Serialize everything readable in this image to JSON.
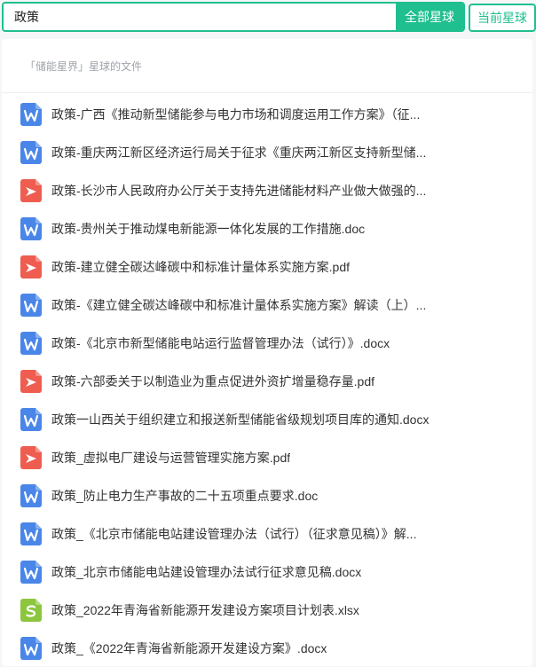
{
  "search": {
    "value": "政策",
    "all_button": "全部星球",
    "current_button": "当前星球"
  },
  "panel": {
    "title": "「储能星界」星球的文件"
  },
  "colors": {
    "accent": "#1fbf8f",
    "word": "#4a86e8",
    "pdf": "#ee5d4f",
    "excel": "#8cc63f"
  },
  "files": [
    {
      "type": "word",
      "icon": "word-file-icon",
      "name": "政策-广西《推动新型储能参与电力市场和调度运用工作方案》（征..."
    },
    {
      "type": "word",
      "icon": "word-file-icon",
      "name": "政策-重庆两江新区经济运行局关于征求《重庆两江新区支持新型储..."
    },
    {
      "type": "pdf",
      "icon": "pdf-file-icon",
      "name": "政策-长沙市人民政府办公厅关于支持先进储能材料产业做大做强的..."
    },
    {
      "type": "word",
      "icon": "word-file-icon",
      "name": "政策-贵州关于推动煤电新能源一体化发展的工作措施.doc"
    },
    {
      "type": "pdf",
      "icon": "pdf-file-icon",
      "name": "政策-建立健全碳达峰碳中和标准计量体系实施方案.pdf"
    },
    {
      "type": "word",
      "icon": "word-file-icon",
      "name": "政策-《建立健全碳达峰碳中和标准计量体系实施方案》解读（上）..."
    },
    {
      "type": "word",
      "icon": "word-file-icon",
      "name": "政策-《北京市新型储能电站运行监督管理办法（试行）》.docx"
    },
    {
      "type": "pdf",
      "icon": "pdf-file-icon",
      "name": "政策-六部委关于以制造业为重点促进外资扩增量稳存量.pdf"
    },
    {
      "type": "word",
      "icon": "word-file-icon",
      "name": "政策一山西关于组织建立和报送新型储能省级规划项目库的通知.docx"
    },
    {
      "type": "pdf",
      "icon": "pdf-file-icon",
      "name": "政策_虚拟电厂建设与运营管理实施方案.pdf"
    },
    {
      "type": "word",
      "icon": "word-file-icon",
      "name": "政策_防止电力生产事故的二十五项重点要求.doc"
    },
    {
      "type": "word",
      "icon": "word-file-icon",
      "name": "政策_《北京市储能电站建设管理办法（试行）（征求意见稿）》解..."
    },
    {
      "type": "word",
      "icon": "word-file-icon",
      "name": "政策_北京市储能电站建设管理办法试行征求意见稿.docx"
    },
    {
      "type": "excel",
      "icon": "excel-file-icon",
      "name": "政策_2022年青海省新能源开发建设方案项目计划表.xlsx"
    },
    {
      "type": "word",
      "icon": "word-file-icon",
      "name": "政策_《2022年青海省新能源开发建设方案》.docx"
    }
  ]
}
